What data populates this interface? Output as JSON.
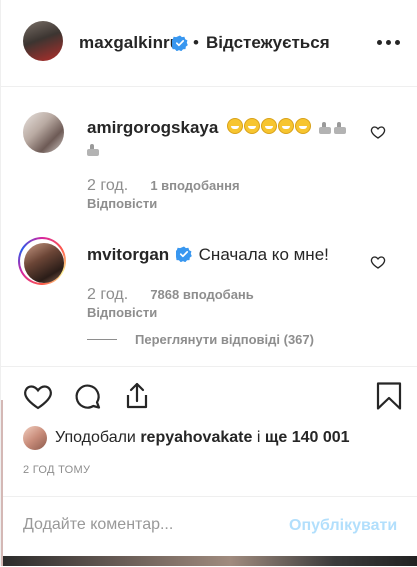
{
  "header": {
    "username": "maxgalkinru",
    "separator": "•",
    "follow_status": "Відстежується"
  },
  "comments": [
    {
      "username": "amirgorogskaya",
      "emojis": [
        "grinning-face",
        "grinning-face",
        "grinning-face",
        "grinning-face",
        "grinning-face",
        "thumbs-up",
        "thumbs-up",
        "thumbs-up"
      ],
      "time": "2 год.",
      "likes": "1 вподобання",
      "reply": "Відповісти"
    },
    {
      "username": "mvitorgan",
      "verified": true,
      "text": "Сначала ко мне!",
      "time": "2 год.",
      "likes": "7868 вподобань",
      "reply": "Відповісти",
      "view_replies": "Переглянути відповіді (367)"
    }
  ],
  "liked_by": {
    "prefix": "Уподобали",
    "user": "repyahovakate",
    "connector": "і",
    "others": "ще 140 001"
  },
  "time_ago": "2 ГОД ТОМУ",
  "comment_input": {
    "placeholder": "Додайте коментар...",
    "value": ""
  },
  "publish_label": "Опублікувати",
  "colors": {
    "verified": "#3897f0",
    "publish_disabled": "#b2dffc",
    "secondary_text": "#8e8e8e"
  }
}
